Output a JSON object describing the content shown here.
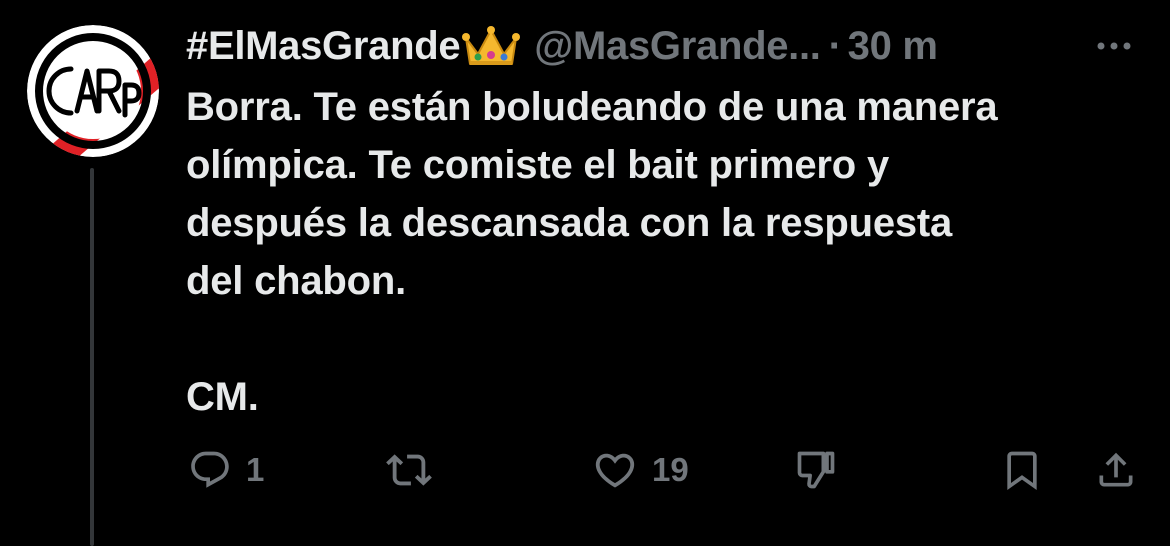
{
  "tweet": {
    "display_name": "#ElMasGrande",
    "badge_icon": "crown-emoji",
    "handle": "@MasGrande...",
    "separator": "·",
    "time": "30 m",
    "more_icon": "more-dots-icon",
    "avatar": {
      "logo_text": "CARP",
      "colors": {
        "red": "#e02126",
        "white": "#ffffff",
        "black": "#000000"
      }
    },
    "body_lines": [
      "Borra. Te están boludeando de una manera",
      "olímpica. Te comiste el bait primero y",
      "después la descansada con la respuesta",
      "del chabon."
    ],
    "signature": "CM.",
    "actions": {
      "reply": {
        "icon": "reply-icon",
        "count": "1"
      },
      "retweet": {
        "icon": "retweet-icon",
        "count": ""
      },
      "like": {
        "icon": "heart-icon",
        "count": "19"
      },
      "dislike": {
        "icon": "thumbs-down-icon",
        "count": ""
      },
      "bookmark": {
        "icon": "bookmark-icon"
      },
      "share": {
        "icon": "share-icon"
      }
    }
  },
  "theme": {
    "background": "#000000",
    "text": "#e7e9ea",
    "muted": "#71767b",
    "thread_line": "#333639"
  }
}
